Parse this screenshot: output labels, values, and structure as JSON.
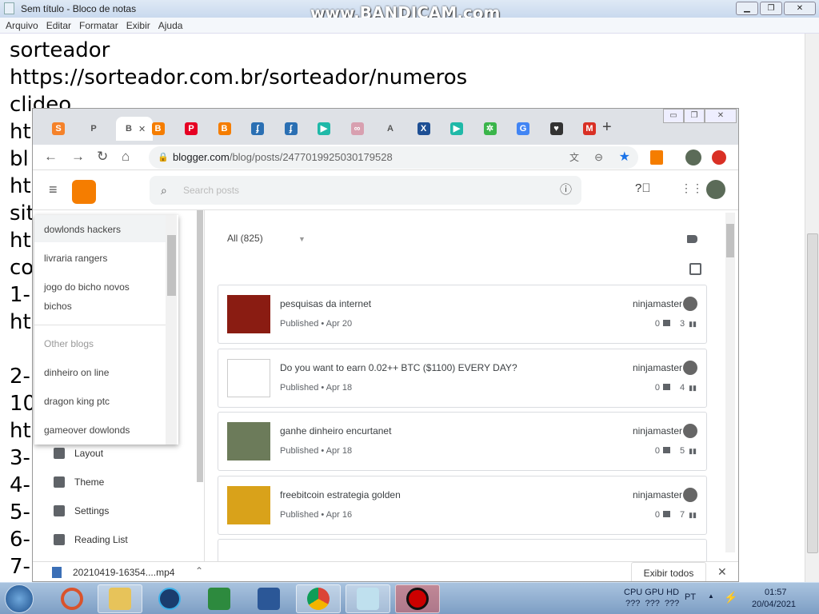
{
  "notepad": {
    "title": "Sem título - Bloco de notas",
    "menu": [
      "Arquivo",
      "Editar",
      "Formatar",
      "Exibir",
      "Ajuda"
    ],
    "lines": [
      "sorteador",
      "https://sorteador.com.br/sorteador/numeros",
      "clideo",
      "ht",
      "bl",
      "ht",
      "sit",
      "ht",
      "co",
      "1-",
      "ht",
      "",
      "2-",
      "10",
      "ht",
      "3-",
      "4-",
      "5-",
      "6-",
      "7-"
    ]
  },
  "watermark": "www.BANDICAM.com",
  "chrome": {
    "tabs": [
      {
        "label": "S",
        "color": "#f5822a"
      },
      {
        "label": "P",
        "color": "#888"
      },
      {
        "label": "B",
        "color": "#888",
        "active": true
      },
      {
        "label": "B",
        "color": "#f57d00"
      },
      {
        "label": "P",
        "color": "#e60023"
      },
      {
        "label": "B",
        "color": "#f57d00"
      },
      {
        "label": "ʄ",
        "color": "#2a6fb3"
      },
      {
        "label": "ʄ",
        "color": "#2a6fb3"
      },
      {
        "label": "▶",
        "color": "#1fb9a8"
      },
      {
        "label": "∞",
        "color": "#d8a0b0"
      },
      {
        "label": "A",
        "color": "#888"
      },
      {
        "label": "X",
        "color": "#1e4f94"
      },
      {
        "label": "▶",
        "color": "#1fb9a8"
      },
      {
        "label": "✲",
        "color": "#3ab54a"
      },
      {
        "label": "G",
        "color": "#4285f4"
      },
      {
        "label": "♥",
        "color": "#333"
      },
      {
        "label": "M",
        "color": "#d93025"
      }
    ],
    "new_tab": "+",
    "url_host": "blogger.com",
    "url_path": "/blog/posts/2477019925030179528"
  },
  "blogger": {
    "search_placeholder": "Search posts",
    "filter": "All (825)",
    "blog_menu": {
      "items": [
        "dowlonds hackers",
        "livraria rangers",
        "jogo do bicho novos",
        "bichos"
      ],
      "other_header": "Other blogs",
      "other": [
        "dinheiro on line",
        "dragon king ptc",
        "gameover dowlonds"
      ]
    },
    "nav": [
      {
        "label": "Layout",
        "icon": "layout-icon"
      },
      {
        "label": "Theme",
        "icon": "paint-roller-icon"
      },
      {
        "label": "Settings",
        "icon": "gear-icon"
      },
      {
        "label": "Reading List",
        "icon": "bookmark-icon"
      }
    ],
    "posts": [
      {
        "title": "pesquisas da internet",
        "status": "Published • Apr 20",
        "author": "ninjamaster",
        "comments": "0",
        "views": "3",
        "thumb": "#8a1c12"
      },
      {
        "title": "Do you want to earn 0.02++ BTC ($1100) EVERY DAY?",
        "status": "Published • Apr 18",
        "author": "ninjamaster",
        "comments": "0",
        "views": "4",
        "thumb": "#ffffff"
      },
      {
        "title": "ganhe dinheiro encurtanet",
        "status": "Published • Apr 18",
        "author": "ninjamaster",
        "comments": "0",
        "views": "5",
        "thumb": "#6c7b5a"
      },
      {
        "title": "freebitcoin estrategia golden",
        "status": "Published • Apr 16",
        "author": "ninjamaster",
        "comments": "0",
        "views": "7",
        "thumb": "#d9a21a"
      }
    ]
  },
  "download": {
    "file": "20210419-16354....mp4",
    "show_all": "Exibir todos"
  },
  "taskbar": {
    "tray_hw": "CPU GPU HD",
    "tray_vals": "???  ???  ???",
    "lang": "PT",
    "time": "01:57",
    "date": "20/04/2021"
  },
  "colors": {
    "blogger": "#f57d00",
    "star": "#1a73e8"
  }
}
